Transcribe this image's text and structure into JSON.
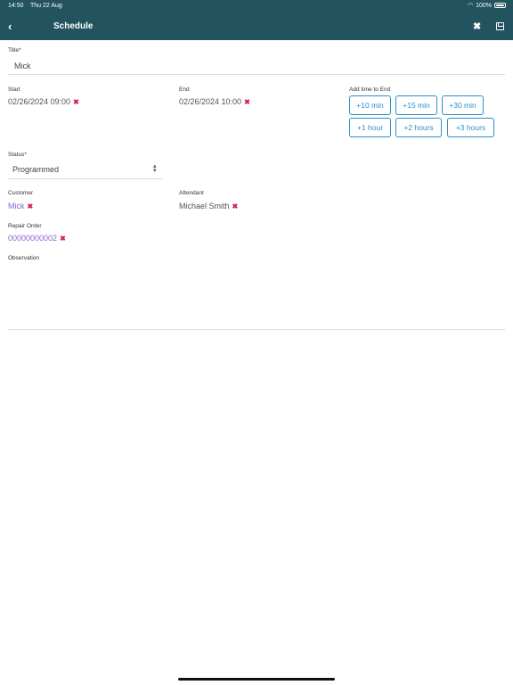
{
  "status_bar": {
    "time": "14:50",
    "date": "Thu 22 Aug",
    "battery": "100%"
  },
  "header": {
    "title": "Schedule",
    "back_icon": "chevron-left-icon",
    "close_icon": "close-icon",
    "save_icon": "save-icon"
  },
  "form": {
    "title_label": "Title*",
    "title_value": "Mick",
    "start_label": "Start",
    "start_value": "02/26/2024 09:00",
    "end_label": "End",
    "end_value": "02/26/2024 10:00",
    "add_time_label": "Add time to End",
    "add_time_buttons": [
      "+10 min",
      "+15 min",
      "+30 min",
      "+1 hour",
      "+2 hours",
      "+3 hours"
    ],
    "status_label": "Status*",
    "status_value": "Programmed",
    "customer_label": "Customer",
    "customer_value": "Mick",
    "attendant_label": "Attendant",
    "attendant_value": "Michael Smith",
    "repair_order_label": "Repair Order",
    "repair_order_value": "00000000002",
    "observation_label": "Observation",
    "observation_value": ""
  },
  "colors": {
    "header_bg": "#22535f",
    "accent": "#2b8fc7",
    "link": "#8a63d2",
    "clear_icon": "#d1225b"
  }
}
